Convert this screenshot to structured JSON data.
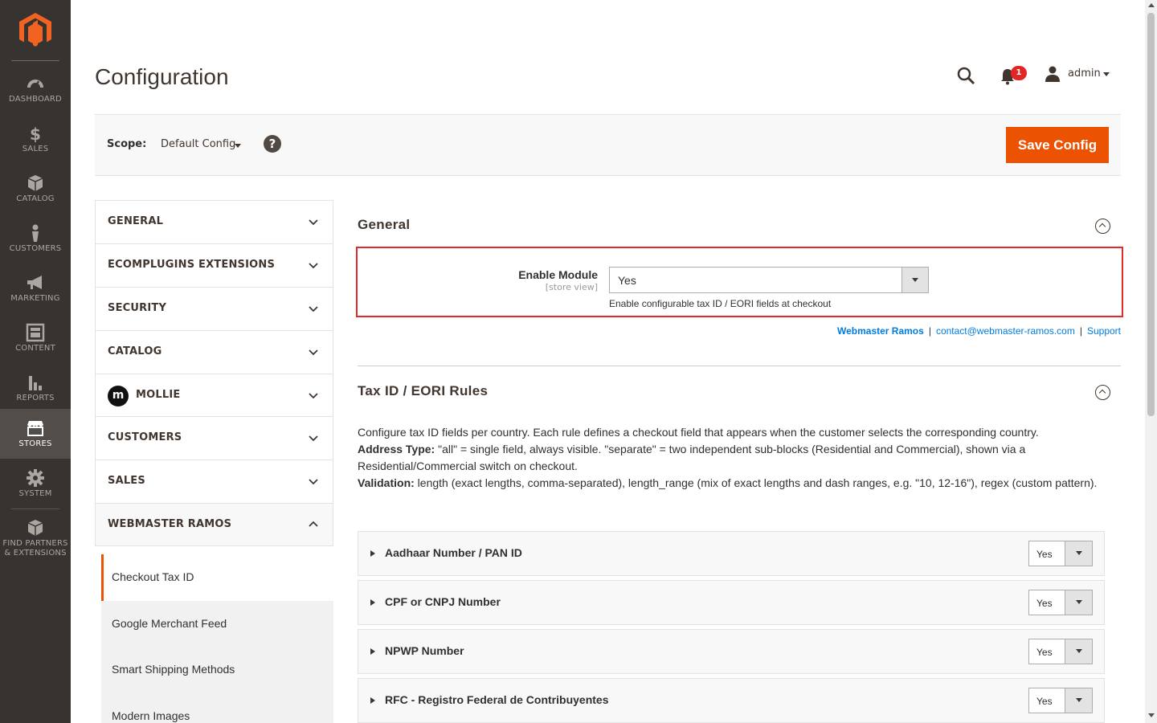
{
  "sidebar": {
    "items": [
      {
        "label": "DASHBOARD",
        "icon": "dashboard-icon"
      },
      {
        "label": "SALES",
        "icon": "dollar-icon"
      },
      {
        "label": "CATALOG",
        "icon": "box-icon"
      },
      {
        "label": "CUSTOMERS",
        "icon": "person-icon"
      },
      {
        "label": "MARKETING",
        "icon": "megaphone-icon"
      },
      {
        "label": "CONTENT",
        "icon": "layout-icon"
      },
      {
        "label": "REPORTS",
        "icon": "bar-chart-icon"
      },
      {
        "label": "STORES",
        "icon": "store-icon"
      },
      {
        "label": "SYSTEM",
        "icon": "gear-icon"
      },
      {
        "label": "FIND PARTNERS",
        "label2": "& EXTENSIONS",
        "icon": "partners-icon"
      }
    ]
  },
  "header": {
    "title": "Configuration",
    "notification_count": "1",
    "user": "admin"
  },
  "scope": {
    "label": "Scope:",
    "value": "Default Config",
    "help": "?",
    "save_label": "Save Config"
  },
  "config_nav": {
    "tabs": [
      "GENERAL",
      "ECOMPLUGINS EXTENSIONS",
      "SECURITY",
      "CATALOG",
      "MOLLIE",
      "CUSTOMERS",
      "SALES",
      "WEBMASTER RAMOS"
    ],
    "mollie_logo": "m",
    "sub_items": [
      "Checkout Tax ID",
      "Google Merchant Feed",
      "Smart Shipping Methods",
      "Modern Images"
    ]
  },
  "general": {
    "title": "General",
    "field_label": "Enable Module",
    "field_scope": "[store view]",
    "field_value": "Yes",
    "field_note": "Enable configurable tax ID / EORI fields at checkout"
  },
  "links": {
    "vendor": "Webmaster Ramos",
    "sep": "|",
    "email": "contact@webmaster-ramos.com",
    "support": "Support"
  },
  "rules": {
    "title": "Tax ID / EORI Rules",
    "desc_line1": "Configure tax ID fields per country. Each rule defines a checkout field that appears when the customer selects the corresponding country.",
    "address_type_label": "Address Type:",
    "address_type_text": " \"all\" = single field, always visible. \"separate\" = two independent sub-blocks (Residential and Commercial), shown via a Residential/Commercial switch on checkout.",
    "validation_label": "Validation:",
    "validation_text": " length (exact lengths, comma-separated), length_range (mix of exact lengths and dash ranges, e.g. \"10, 12-16\"), regex (custom pattern).",
    "items": [
      {
        "name": "Aadhaar Number / PAN ID",
        "value": "Yes"
      },
      {
        "name": "CPF or CNPJ Number",
        "value": "Yes"
      },
      {
        "name": "NPWP Number",
        "value": "Yes"
      },
      {
        "name": "RFC - Registro Federal de Contribuyentes",
        "value": "Yes"
      }
    ]
  },
  "colors": {
    "sidebar_bg": "#373330",
    "accent": "#eb5202",
    "link": "#007bdb",
    "highlight": "#e02b27"
  }
}
